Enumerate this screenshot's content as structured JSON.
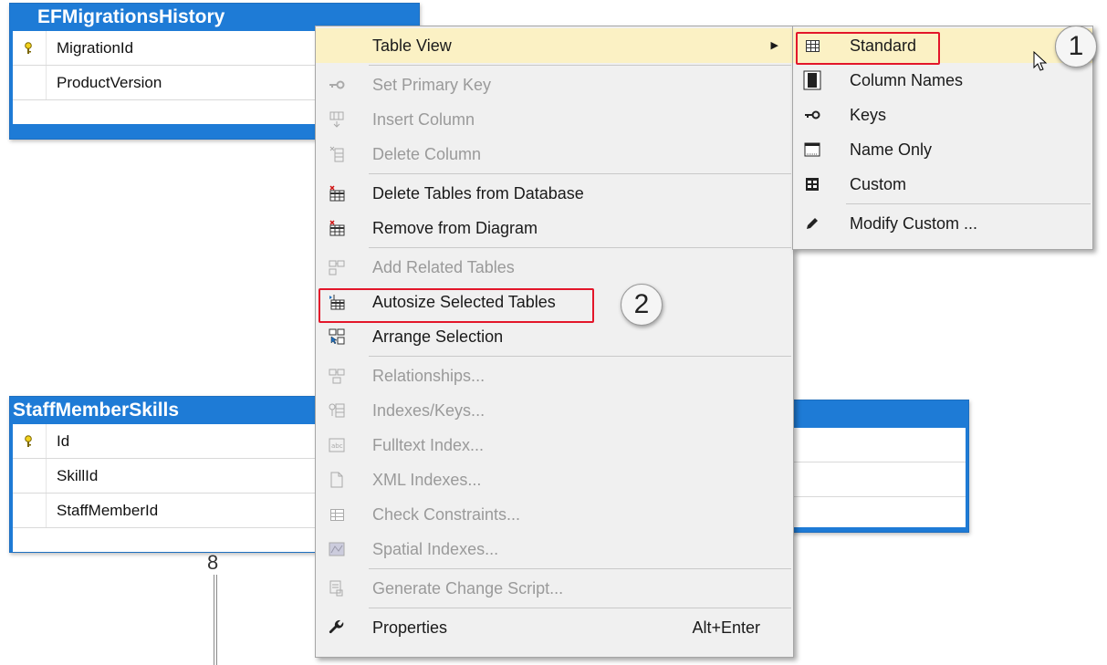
{
  "tables": {
    "ef_migrations": {
      "title": "EFMigrationsHistory",
      "columns": [
        {
          "name": "MigrationId",
          "is_key": true
        },
        {
          "name": "ProductVersion",
          "is_key": false
        }
      ]
    },
    "staff_member_skills": {
      "title": "StaffMemberSkills",
      "columns": [
        {
          "name": "Id",
          "is_key": true
        },
        {
          "name": "SkillId",
          "is_key": false
        },
        {
          "name": "StaffMemberId",
          "is_key": false
        }
      ]
    }
  },
  "relationship_end_symbol": "8",
  "context_menu": {
    "items": [
      {
        "label": "Table View",
        "icon": "none",
        "enabled": true,
        "submenu": true
      },
      {
        "label": "Set Primary Key",
        "icon": "key-icon",
        "enabled": false
      },
      {
        "label": "Insert Column",
        "icon": "insert-column-icon",
        "enabled": false
      },
      {
        "label": "Delete Column",
        "icon": "delete-column-icon",
        "enabled": false
      },
      {
        "label": "Delete Tables from Database",
        "icon": "delete-table-icon",
        "enabled": true
      },
      {
        "label": "Remove from Diagram",
        "icon": "remove-table-icon",
        "enabled": true
      },
      {
        "label": "Add Related Tables",
        "icon": "add-related-tables-icon",
        "enabled": false
      },
      {
        "label": "Autosize Selected Tables",
        "icon": "autosize-table-icon",
        "enabled": true
      },
      {
        "label": "Arrange Selection",
        "icon": "arrange-selection-icon",
        "enabled": true
      },
      {
        "label": "Relationships...",
        "icon": "relationships-icon",
        "enabled": false
      },
      {
        "label": "Indexes/Keys...",
        "icon": "indexes-keys-icon",
        "enabled": false
      },
      {
        "label": "Fulltext Index...",
        "icon": "fulltext-index-icon",
        "enabled": false
      },
      {
        "label": "XML Indexes...",
        "icon": "xml-indexes-icon",
        "enabled": false
      },
      {
        "label": "Check Constraints...",
        "icon": "check-constraints-icon",
        "enabled": false
      },
      {
        "label": "Spatial Indexes...",
        "icon": "spatial-indexes-icon",
        "enabled": false
      },
      {
        "label": "Generate Change Script...",
        "icon": "change-script-icon",
        "enabled": false
      },
      {
        "label": "Properties",
        "icon": "wrench-icon",
        "enabled": true,
        "shortcut": "Alt+Enter"
      }
    ]
  },
  "table_view_submenu": {
    "items": [
      {
        "label": "Standard",
        "icon": "grid-icon",
        "highlighted": true
      },
      {
        "label": "Column Names",
        "icon": "column-names-icon"
      },
      {
        "label": "Keys",
        "icon": "key-icon"
      },
      {
        "label": "Name Only",
        "icon": "name-only-icon"
      },
      {
        "label": "Custom",
        "icon": "custom-view-icon"
      },
      {
        "label": "Modify Custom ...",
        "icon": "pencil-icon"
      }
    ]
  },
  "callouts": {
    "step1": "1",
    "step2": "2"
  },
  "colors": {
    "table_header": "#1e7bd6",
    "menu_background": "#f0f0f0",
    "highlight": "#fbf1c4",
    "callout_border": "#e3162a"
  }
}
